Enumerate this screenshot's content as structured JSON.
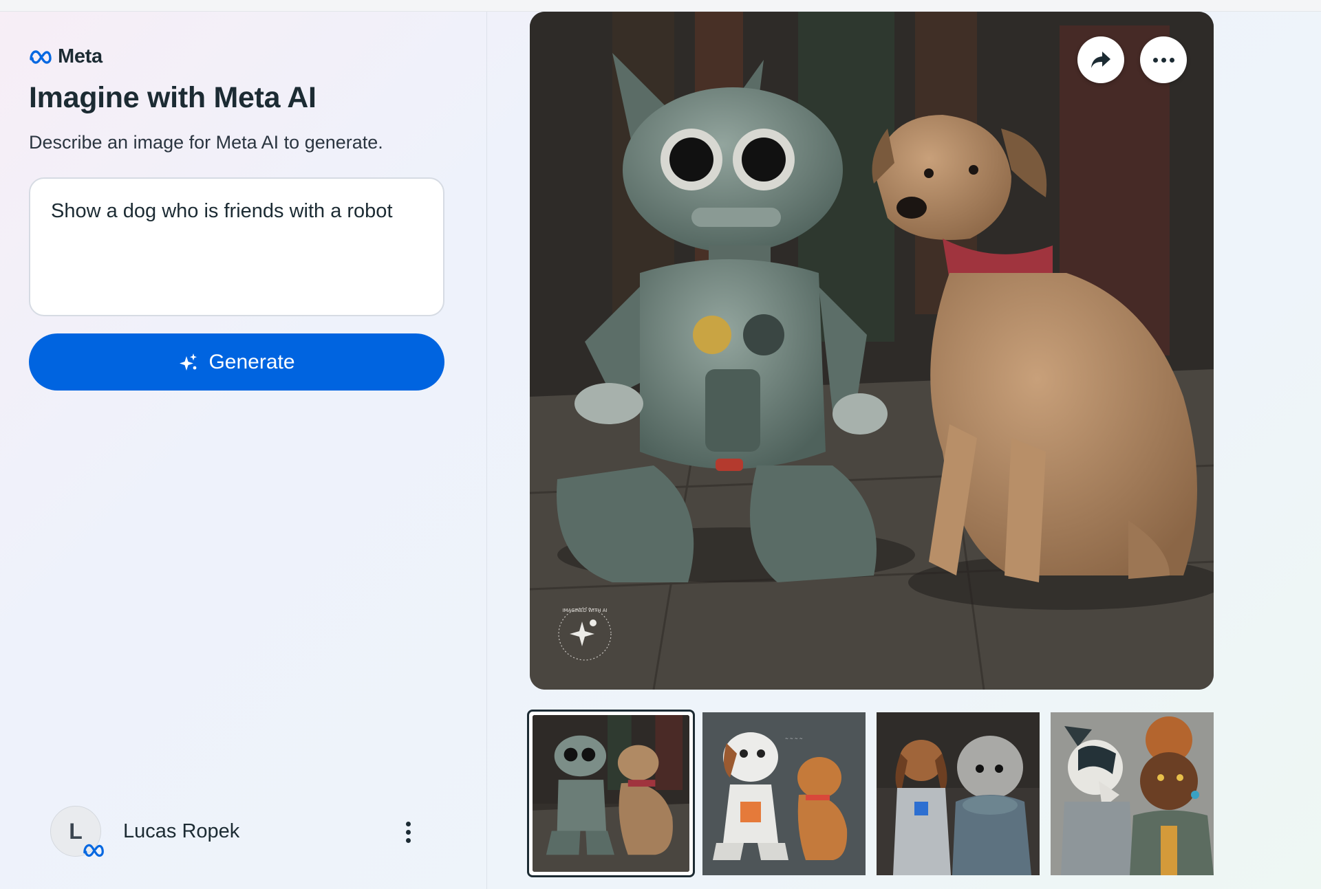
{
  "brand": {
    "name": "Meta",
    "logo_icon": "meta-infinity-icon"
  },
  "header": {
    "title": "Imagine with Meta AI",
    "subtitle": "Describe an image for Meta AI to generate."
  },
  "prompt": {
    "value": "Show a dog who is friends with a robot"
  },
  "generate": {
    "label": "Generate",
    "icon": "sparkle-icon"
  },
  "user": {
    "initial": "L",
    "name": "Lucas Ropek",
    "badge_icon": "meta-infinity-icon",
    "menu_icon": "kebab-menu-icon"
  },
  "image_actions": {
    "share_icon": "share-arrow-icon",
    "more_icon": "more-horizontal-icon"
  },
  "watermark": {
    "text": "IMAGINED WITH AI"
  },
  "thumbnails": [
    {
      "index": 1,
      "selected": true
    },
    {
      "index": 2,
      "selected": false
    },
    {
      "index": 3,
      "selected": false
    },
    {
      "index": 4,
      "selected": false
    }
  ],
  "colors": {
    "accent": "#0064e0",
    "text": "#1c2b33"
  }
}
